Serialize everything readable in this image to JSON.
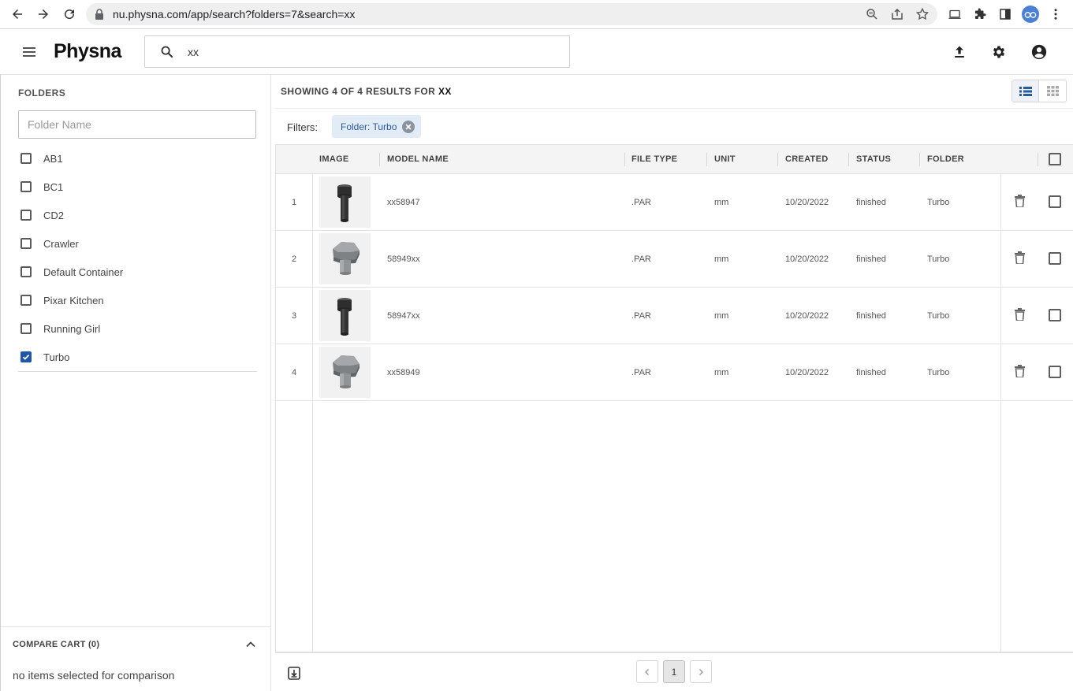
{
  "browser": {
    "url": "nu.physna.com/app/search?folders=7&search=xx"
  },
  "app": {
    "brand": "Physna",
    "search_value": "xx"
  },
  "sidebar": {
    "folders_title": "FOLDERS",
    "folder_placeholder": "Folder Name",
    "folders": [
      {
        "label": "AB1",
        "checked": false
      },
      {
        "label": "BC1",
        "checked": false
      },
      {
        "label": "CD2",
        "checked": false
      },
      {
        "label": "Crawler",
        "checked": false
      },
      {
        "label": "Default Container",
        "checked": false
      },
      {
        "label": "Pixar Kitchen",
        "checked": false
      },
      {
        "label": "Running Girl",
        "checked": false
      },
      {
        "label": "Turbo",
        "checked": true
      }
    ],
    "compare_title": "COMPARE CART (0)",
    "compare_message": "no items selected for comparison"
  },
  "results": {
    "summary_prefix": "SHOWING 4 OF 4 RESULTS FOR",
    "query": "XX",
    "filters_label": "Filters:",
    "filter_chip": "Folder: Turbo"
  },
  "table": {
    "columns": [
      "IMAGE",
      "MODEL NAME",
      "FILE TYPE",
      "UNIT",
      "CREATED",
      "STATUS",
      "FOLDER"
    ],
    "rows": [
      {
        "index": "1",
        "model": "xx58947",
        "file_type": ".PAR",
        "unit": "mm",
        "created": "10/20/2022",
        "status": "finished",
        "folder": "Turbo",
        "thumb": "bolt-dark"
      },
      {
        "index": "2",
        "model": "58949xx",
        "file_type": ".PAR",
        "unit": "mm",
        "created": "10/20/2022",
        "status": "finished",
        "folder": "Turbo",
        "thumb": "hex-bolt-gray"
      },
      {
        "index": "3",
        "model": "58947xx",
        "file_type": ".PAR",
        "unit": "mm",
        "created": "10/20/2022",
        "status": "finished",
        "folder": "Turbo",
        "thumb": "bolt-dark"
      },
      {
        "index": "4",
        "model": "xx58949",
        "file_type": ".PAR",
        "unit": "mm",
        "created": "10/20/2022",
        "status": "finished",
        "folder": "Turbo",
        "thumb": "hex-bolt-gray"
      }
    ]
  },
  "pagination": {
    "current_page": "1"
  },
  "colors": {
    "accent": "#1e55a8",
    "chip_bg": "#e2ecf7"
  }
}
